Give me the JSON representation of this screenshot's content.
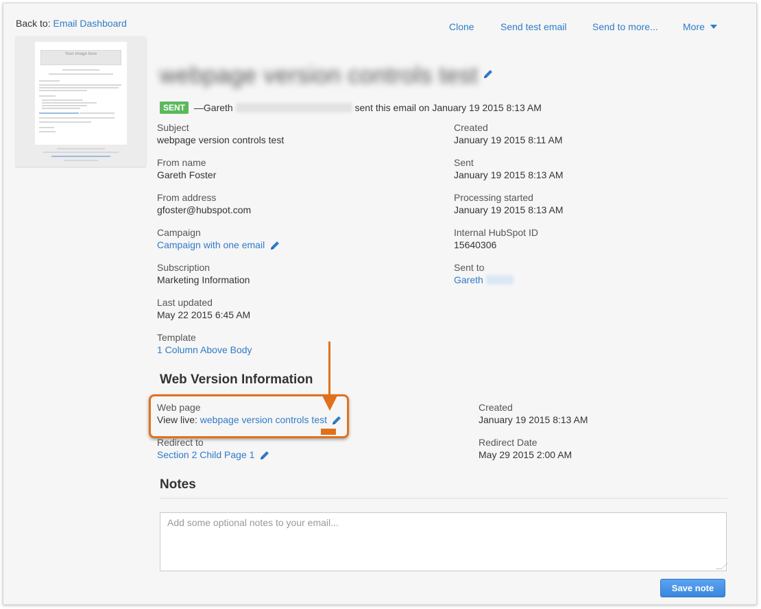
{
  "nav": {
    "back_prefix": "Back to:",
    "back_link": "Email Dashboard",
    "clone": "Clone",
    "send_test": "Send test email",
    "send_more": "Send to more...",
    "more": "More"
  },
  "thumbnail": {
    "image_placeholder": "Your image here"
  },
  "email": {
    "title": "webpage version controls test",
    "status_badge": "SENT",
    "sender_prefix": "—Gareth",
    "sent_text": "sent this email on January 19 2015 8:13 AM"
  },
  "details_left": {
    "subject_label": "Subject",
    "subject_value": "webpage version controls test",
    "from_name_label": "From name",
    "from_name_value": "Gareth Foster",
    "from_address_label": "From address",
    "from_address_value": "gfoster@hubspot.com",
    "campaign_label": "Campaign",
    "campaign_value": "Campaign with one email",
    "subscription_label": "Subscription",
    "subscription_value": "Marketing Information",
    "last_updated_label": "Last updated",
    "last_updated_value": "May 22 2015 6:45 AM",
    "template_label": "Template",
    "template_value": "1 Column Above Body"
  },
  "details_right": {
    "created_label": "Created",
    "created_value": "January 19 2015 8:11 AM",
    "sent_label": "Sent",
    "sent_value": "January 19 2015 8:13 AM",
    "processing_label": "Processing started",
    "processing_value": "January 19 2015 8:13 AM",
    "internal_id_label": "Internal HubSpot ID",
    "internal_id_value": "15640306",
    "sent_to_label": "Sent to",
    "sent_to_value": "Gareth"
  },
  "web_version": {
    "heading": "Web Version Information",
    "web_page_label": "Web page",
    "view_live_prefix": "View live:",
    "view_live_link": "webpage version controls test",
    "redirect_label": "Redirect to",
    "redirect_value": "Section 2 Child Page 1",
    "created_label": "Created",
    "created_value": "January 19 2015 8:13 AM",
    "redirect_date_label": "Redirect Date",
    "redirect_date_value": "May 29 2015 2:00 AM"
  },
  "notes": {
    "heading": "Notes",
    "placeholder": "Add some optional notes to your email...",
    "save_label": "Save note"
  },
  "colors": {
    "link": "#2f7bc8",
    "badge": "#5cb85c",
    "annotation": "#e0711c",
    "button": "#3b86dd"
  }
}
